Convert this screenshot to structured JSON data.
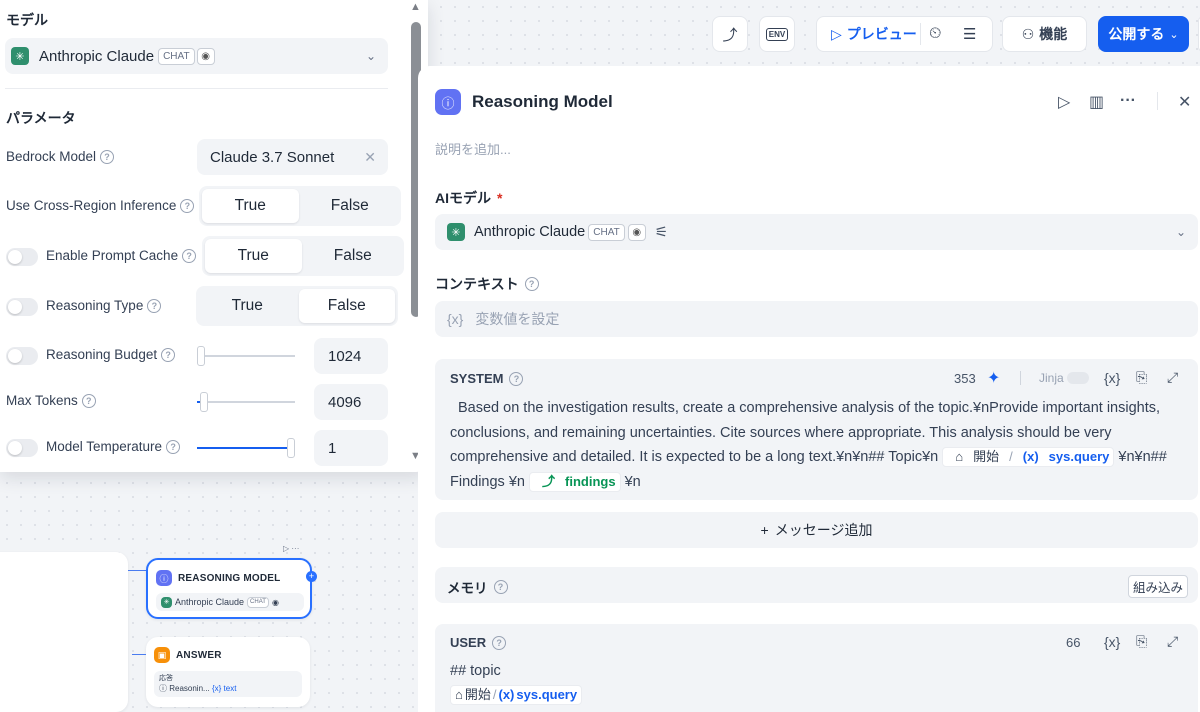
{
  "popover": {
    "model_section_label": "モデル",
    "model": {
      "name": "Anthropic Claude",
      "badge": "CHAT"
    },
    "params_section_label": "パラメータ",
    "params": {
      "bedrock_model": {
        "label": "Bedrock Model",
        "value": "Claude 3.7 Sonnet"
      },
      "cross_region": {
        "label": "Use Cross-Region Inference",
        "options": [
          "True",
          "False"
        ],
        "selected": "True"
      },
      "prompt_cache": {
        "label": "Enable Prompt Cache",
        "options": [
          "True",
          "False"
        ],
        "selected": "True"
      },
      "reasoning_type": {
        "label": "Reasoning Type",
        "options": [
          "True",
          "False"
        ],
        "selected": "False"
      },
      "reasoning_budget": {
        "label": "Reasoning Budget",
        "value": "1024"
      },
      "max_tokens": {
        "label": "Max Tokens",
        "value": "4096"
      },
      "temperature": {
        "label": "Model Temperature",
        "value": "1"
      }
    }
  },
  "canvas": {
    "reasoning_node": {
      "title": "REASONING MODEL",
      "model": "Anthropic Claude",
      "badge": "CHAT"
    },
    "answer_node": {
      "title": "ANSWER",
      "field_label": "応答",
      "ref_node": "Reasonin...",
      "ref_var": "text"
    }
  },
  "toolbar": {
    "env_label": "ENV",
    "preview_label": "プレビュー",
    "features_label": "機能",
    "publish_label": "公開する",
    "accent_color": "#155eef"
  },
  "panel": {
    "title": "Reasoning Model",
    "description_placeholder": "説明を追加...",
    "ai_model_label": "AIモデル",
    "required_mark": "*",
    "model": {
      "name": "Anthropic Claude",
      "badge": "CHAT"
    },
    "context_label": "コンテキスト",
    "context_placeholder": "変数値を設定",
    "system": {
      "label": "SYSTEM",
      "count": "353",
      "jinja": "Jinja",
      "text_part1": "Based on the investigation results, create a comprehensive analysis of the topic.¥nProvide important insights, conclusions, and remaining uncertainties. Cite sources where appropriate. This analysis should be very comprehensive and detailed. It is expected to be a long text.¥n¥n## Topic¥n",
      "var1_node": "開始",
      "var1_name": "sys.query",
      "text_part2": "¥n¥n## Findings ¥n",
      "var2_name": "findings",
      "text_part3": "¥n"
    },
    "add_message_label": "メッセージ追加",
    "memory_label": "メモリ",
    "builtin_label": "組み込み",
    "user": {
      "label": "USER",
      "count": "66",
      "line1": "## topic",
      "var_node": "開始",
      "var_name": "sys.query"
    }
  }
}
